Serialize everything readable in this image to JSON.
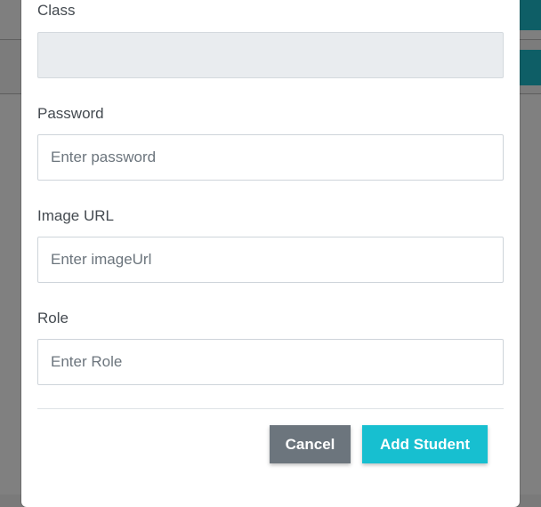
{
  "form": {
    "class": {
      "label": "Class",
      "value": "",
      "placeholder": ""
    },
    "password": {
      "label": "Password",
      "value": "",
      "placeholder": "Enter password"
    },
    "image_url": {
      "label": "Image URL",
      "value": "",
      "placeholder": "Enter imageUrl"
    },
    "role": {
      "label": "Role",
      "value": "",
      "placeholder": "Enter Role"
    }
  },
  "footer": {
    "cancel_label": "Cancel",
    "submit_label": "Add Student"
  },
  "colors": {
    "submit_button": "#17bfd0",
    "cancel_button": "#6c757d",
    "overlay": "#808080"
  }
}
